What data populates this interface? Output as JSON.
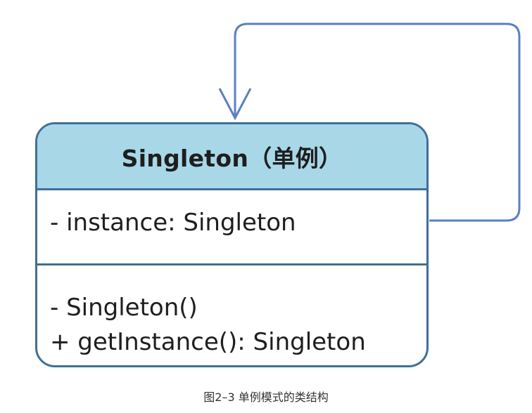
{
  "diagram": {
    "class_name": "Singleton（单例）",
    "attributes": [
      "- instance: Singleton"
    ],
    "methods": [
      "- Singleton()",
      "+ getInstance(): Singleton"
    ],
    "caption": "图2–3 单例模式的类结构",
    "colors": {
      "header_fill": "#a8d8e8",
      "border": "#3f6f97",
      "arrow": "#5b7fc0"
    }
  }
}
